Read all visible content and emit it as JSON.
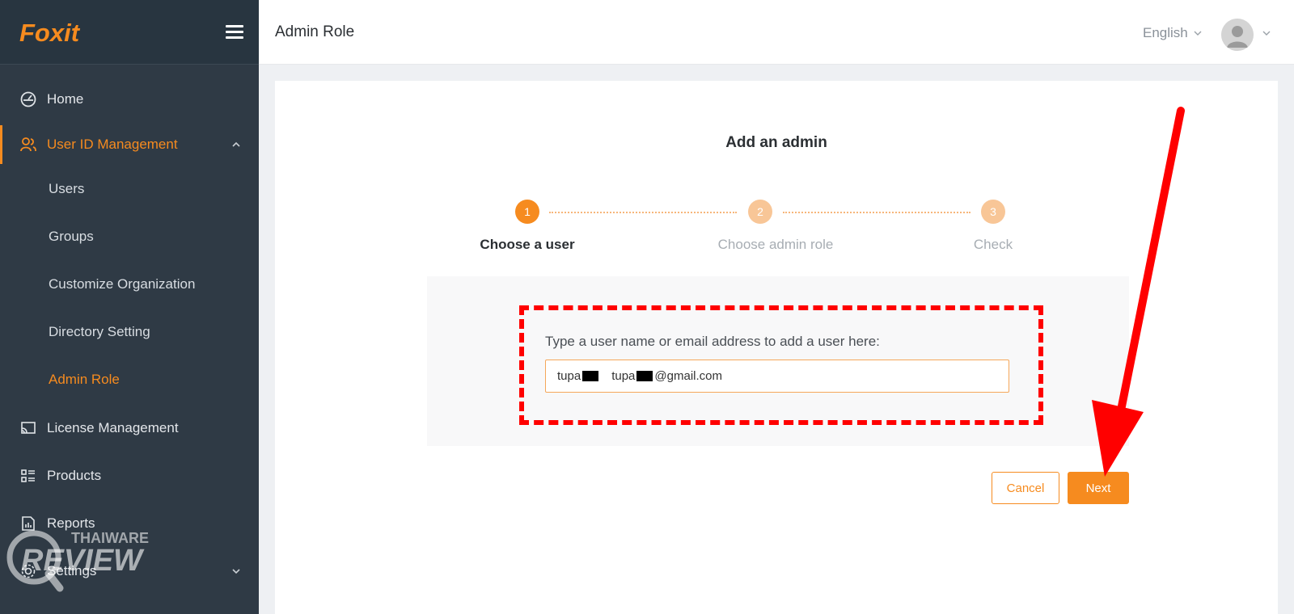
{
  "brand": {
    "logo_text": "Foxit",
    "accent_color": "#f68b1f",
    "sidebar_bg": "#2f3a45"
  },
  "sidebar": {
    "items": [
      {
        "label": "Home",
        "icon": "dashboard-icon"
      },
      {
        "label": "User ID Management",
        "icon": "users-icon",
        "expanded": true
      },
      {
        "label": "License Management",
        "icon": "license-icon"
      },
      {
        "label": "Products",
        "icon": "products-icon"
      },
      {
        "label": "Reports",
        "icon": "reports-icon"
      },
      {
        "label": "Settings",
        "icon": "gear-icon"
      }
    ],
    "subitems": [
      {
        "label": "Users"
      },
      {
        "label": "Groups"
      },
      {
        "label": "Customize Organization"
      },
      {
        "label": "Directory Setting"
      },
      {
        "label": "Admin Role",
        "active": true
      }
    ]
  },
  "header": {
    "title": "Admin Role",
    "language": "English"
  },
  "wizard": {
    "title": "Add an admin",
    "steps": [
      {
        "number": "1",
        "label": "Choose a user",
        "state": "current"
      },
      {
        "number": "2",
        "label": "Choose admin role",
        "state": "pending"
      },
      {
        "number": "3",
        "label": "Check",
        "state": "pending"
      }
    ],
    "instruction": "Type a user name or email address to add a user here:",
    "input": {
      "name_prefix": "tupa",
      "email_prefix": "tupa",
      "email_suffix": "@gmail.com"
    },
    "cancel_label": "Cancel",
    "next_label": "Next"
  },
  "watermark": {
    "line1": "THAIWARE",
    "line2": "REVIEW"
  }
}
